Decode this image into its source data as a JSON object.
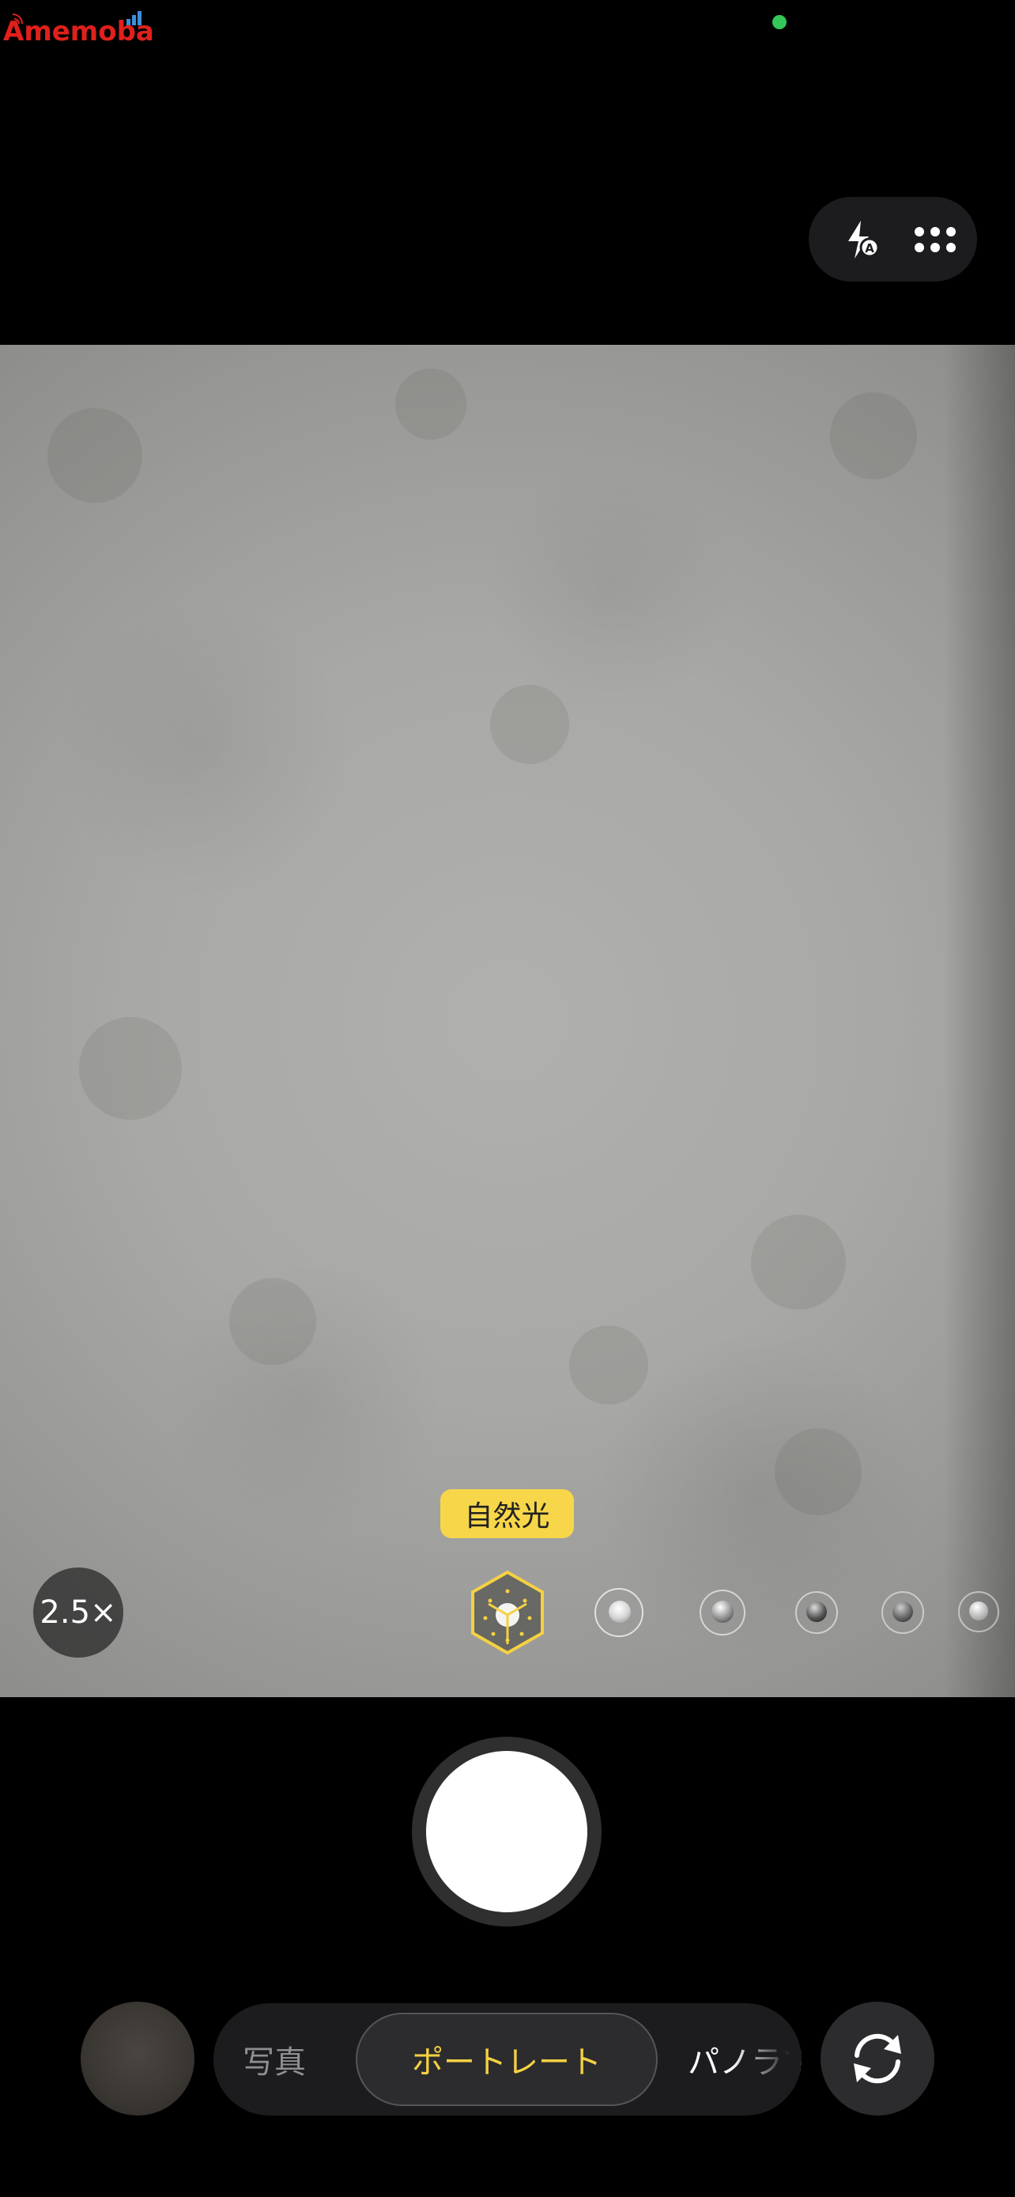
{
  "watermark": {
    "text": "Amemoba"
  },
  "top_controls": {
    "flash_icon": "flash-auto-icon",
    "more_icon": "more-options-icon"
  },
  "viewfinder": {
    "zoom_label": "2.5×",
    "lighting_label": "自然光",
    "lighting_options": [
      "natural-light",
      "studio-light",
      "contour-light",
      "stage-light",
      "stage-light-mono",
      "high-key-light-mono"
    ]
  },
  "shutter": {
    "icon": "shutter-button"
  },
  "modes": {
    "photo": "写真",
    "portrait": "ポートレート",
    "panorama": "パノラマ"
  },
  "bottom": {
    "flip_icon": "camera-flip-icon",
    "thumbnail": "last-photo-thumbnail"
  },
  "colors": {
    "accent": "#f5d142",
    "lighting_badge": "#f7d64a",
    "privacy_dot": "#34c759"
  }
}
